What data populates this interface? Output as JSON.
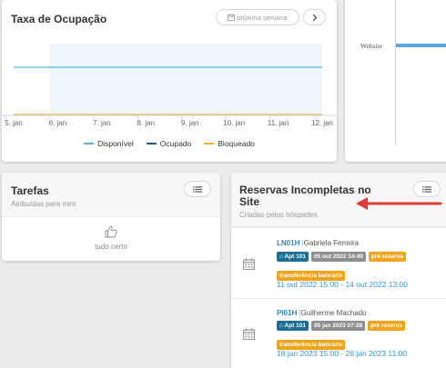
{
  "occupancy": {
    "title": "Taxa de Ocupação",
    "next_week_label": "próxima semana",
    "next_icon": "chevron-right-icon",
    "week_icon": "calendar-icon"
  },
  "chart_data": {
    "type": "line",
    "x": [
      "5. jan",
      "6. jan",
      "7. jan",
      "8. jan",
      "9. jan",
      "10. jan",
      "11. jan",
      "12. jan"
    ],
    "series": [
      {
        "name": "Disponível",
        "color": "#5ab4e5",
        "values": [
          100,
          100,
          100,
          100,
          100,
          100,
          100,
          100
        ]
      },
      {
        "name": "Ocupado",
        "color": "#1b5e8e",
        "values": [
          0,
          0,
          0,
          0,
          0,
          0,
          0,
          0
        ]
      },
      {
        "name": "Bloqueado",
        "color": "#f2b134",
        "values": [
          0,
          0,
          0,
          0,
          0,
          0,
          0,
          0
        ]
      }
    ],
    "highlight_band": [
      "6. jan",
      "12. jan"
    ],
    "grid": true,
    "legend": "bottom"
  },
  "channel": {
    "row_label": "Website",
    "bar_color": "#5aa6de"
  },
  "tasks": {
    "title": "Tarefas",
    "subtitle": "Atribuídas para mim",
    "empty_text": "tudo certo",
    "menu_icon": "list-icon",
    "empty_icon": "thumbs-up-icon"
  },
  "incomplete": {
    "title_line1": "Reservas Incompletas no",
    "title_line2": "Site",
    "subtitle": "Criadas pelos hóspedes",
    "menu_icon": "list-icon",
    "arrow_color": "#e33a35",
    "items": [
      {
        "code": "LN01H",
        "sep": "|",
        "guest": "Gabriela Ferreira",
        "apt_badge": "Apt 101",
        "created_badge": "05 out 2022 14:49",
        "status_badge": "pré reserva",
        "payment_badge": "transferência bancária",
        "dates": "11 out 2022 15:00 - 14 out 2022 13:00",
        "icon": "calendar-icon"
      },
      {
        "code": "PI01H",
        "sep": "|",
        "guest": "Guilherme Machado",
        "apt_badge": "Apt 101",
        "created_badge": "05 jan 2023 07:28",
        "status_badge": "pré reserva",
        "payment_badge": "transferência bancária",
        "dates": "18 jan 2023 15:00 - 26 jan 2023 11:00",
        "icon": "calendar-icon"
      }
    ]
  },
  "colors": {
    "badge_apt": "#1d6e94",
    "badge_created": "#8e8e8e",
    "badge_status": "#efa41a",
    "badge_payment": "#efa41a"
  }
}
